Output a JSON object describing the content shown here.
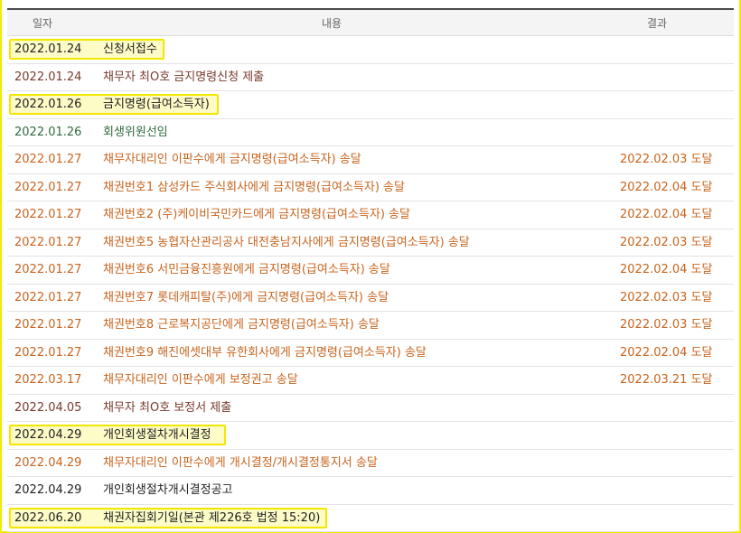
{
  "header": {
    "date": "일자",
    "content": "내용",
    "result": "결과"
  },
  "rows": [
    {
      "date": "2022.01.24",
      "content": "신청서접수",
      "result": "",
      "style": "black",
      "highlight": true,
      "hlw": 172
    },
    {
      "date": "2022.01.24",
      "content": "채무자 최O호 금지명령신청 제출",
      "result": "",
      "style": "darkred",
      "highlight": false
    },
    {
      "date": "2022.01.26",
      "content": "금지명령(급여소득자)",
      "result": "",
      "style": "black",
      "highlight": true,
      "hlw": 232
    },
    {
      "date": "2022.01.26",
      "content": "회생위원선임",
      "result": "",
      "style": "green",
      "highlight": false
    },
    {
      "date": "2022.01.27",
      "content": "채무자대리인 이판수에게 금지명령(급여소득자) 송달",
      "result": "2022.02.03 도달",
      "style": "orange",
      "highlight": false
    },
    {
      "date": "2022.01.27",
      "content": "채권번호1 삼성카드 주식회사에게 금지명령(급여소득자) 송달",
      "result": "2022.02.04 도달",
      "style": "orange",
      "highlight": false
    },
    {
      "date": "2022.01.27",
      "content": "채권번호2 (주)케이비국민카드에게 금지명령(급여소득자) 송달",
      "result": "2022.02.04 도달",
      "style": "orange",
      "highlight": false
    },
    {
      "date": "2022.01.27",
      "content": "채권번호5 농협자산관리공사 대전충남지사에게 금지명령(급여소득자) 송달",
      "result": "2022.02.03 도달",
      "style": "orange",
      "highlight": false
    },
    {
      "date": "2022.01.27",
      "content": "채권번호6 서민금융진흥원에게 금지명령(급여소득자) 송달",
      "result": "2022.02.04 도달",
      "style": "orange",
      "highlight": false
    },
    {
      "date": "2022.01.27",
      "content": "채권번호7 롯데캐피탈(주)에게 금지명령(급여소득자) 송달",
      "result": "2022.02.03 도달",
      "style": "orange",
      "highlight": false
    },
    {
      "date": "2022.01.27",
      "content": "채권번호8 근로복지공단에게 금지명령(급여소득자) 송달",
      "result": "2022.02.03 도달",
      "style": "orange",
      "highlight": false
    },
    {
      "date": "2022.01.27",
      "content": "채권번호9 해진에셋대부 유한회사에게 금지명령(급여소득자) 송달",
      "result": "2022.02.04 도달",
      "style": "orange",
      "highlight": false
    },
    {
      "date": "2022.03.17",
      "content": "채무자대리인 이판수에게 보정권고 송달",
      "result": "2022.03.21 도달",
      "style": "orange",
      "highlight": false
    },
    {
      "date": "2022.04.05",
      "content": "채무자 최O호 보정서 제출",
      "result": "",
      "style": "darkred",
      "highlight": false
    },
    {
      "date": "2022.04.29",
      "content": "개인회생절차개시결정",
      "result": "",
      "style": "black",
      "highlight": true,
      "hlw": 240
    },
    {
      "date": "2022.04.29",
      "content": "채무자대리인 이판수에게 개시결정/개시결정통지서 송달",
      "result": "",
      "style": "orange",
      "highlight": false
    },
    {
      "date": "2022.04.29",
      "content": "개인회생절차개시결정공고",
      "result": "",
      "style": "black",
      "highlight": false
    },
    {
      "date": "2022.06.20",
      "content": "채권자집회기일(본관 제226호 법정 15:20)",
      "result": "",
      "style": "black",
      "highlight": true,
      "hlw": 352
    }
  ],
  "colors": {
    "highlight_border": "#f5e600",
    "highlight_fill": "#fdfbc6",
    "orange": "#c8641e",
    "darkred": "#7a3a2c",
    "green": "#2f6b3f"
  }
}
